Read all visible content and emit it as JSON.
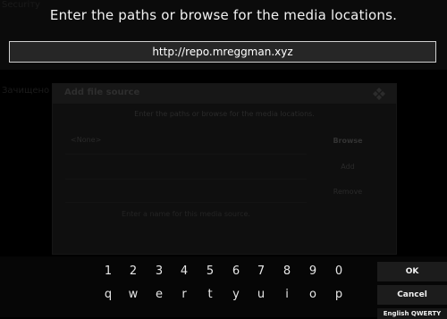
{
  "background": {
    "hint_top": "Ѕeсuriту",
    "hint_mid": "Зачищено"
  },
  "keyboard_prompt": "Enter the paths or browse for the media locations.",
  "url_input": {
    "value": "http://repo.mreggman.xyz"
  },
  "dialog": {
    "title": "Add file source",
    "subtitle": "Enter the paths or browse for the media locations.",
    "path_value": "<None>",
    "browse_label": "Browse",
    "add_label": "Add",
    "remove_label": "Remove",
    "name_hint": "Enter a name for this media source."
  },
  "keyboard": {
    "number_row": [
      "1",
      "2",
      "3",
      "4",
      "5",
      "6",
      "7",
      "8",
      "9",
      "0"
    ],
    "letter_row": [
      "q",
      "w",
      "e",
      "r",
      "t",
      "y",
      "u",
      "i",
      "o",
      "p"
    ],
    "ok_label": "OK",
    "cancel_label": "Cancel",
    "layout_label": "English QWERTY"
  },
  "colors": {
    "background": "#000000",
    "input_border": "#cfcfcf",
    "button_bg": "#1c1c1c"
  }
}
